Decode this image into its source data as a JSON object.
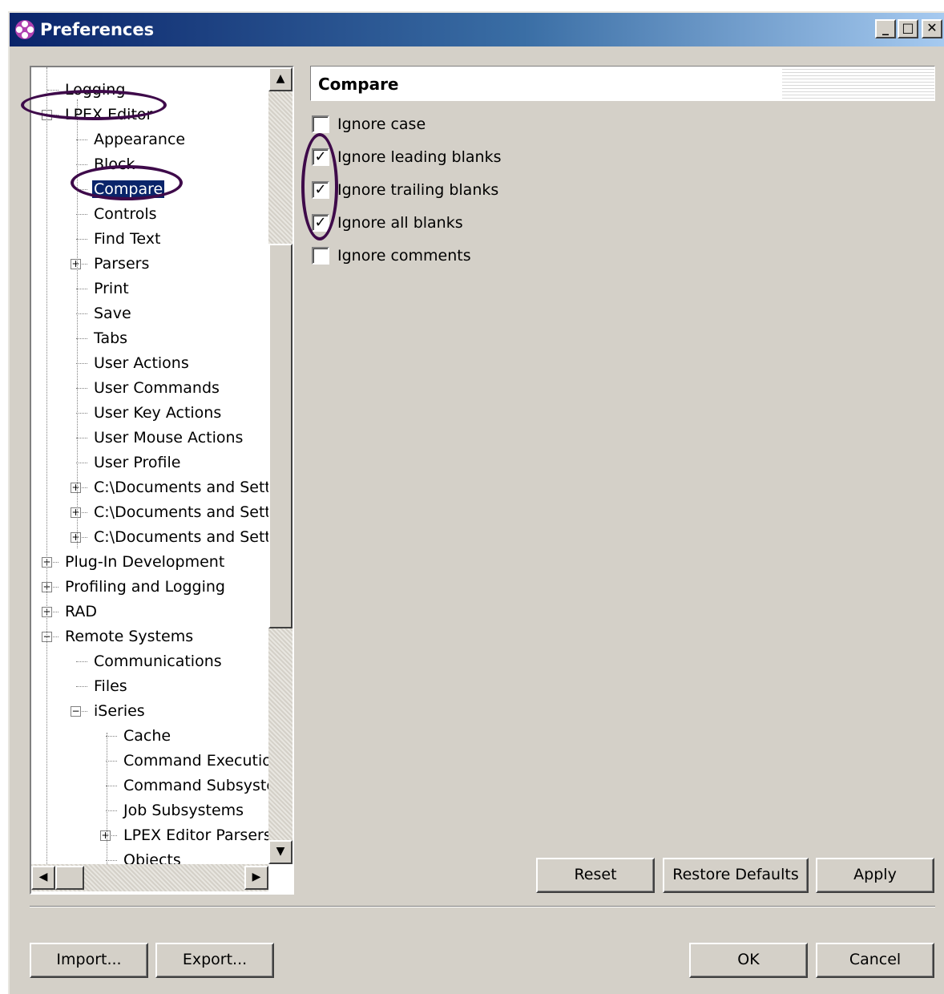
{
  "window": {
    "title": "Preferences"
  },
  "tree": {
    "items": [
      {
        "label": "Logging",
        "level": 1,
        "expander": ""
      },
      {
        "label": "LPEX Editor",
        "level": 1,
        "expander": "−"
      },
      {
        "label": "Appearance",
        "level": 2,
        "expander": ""
      },
      {
        "label": "Block",
        "level": 2,
        "expander": ""
      },
      {
        "label": "Compare",
        "level": 2,
        "expander": "",
        "selected": true
      },
      {
        "label": "Controls",
        "level": 2,
        "expander": ""
      },
      {
        "label": "Find Text",
        "level": 2,
        "expander": ""
      },
      {
        "label": "Parsers",
        "level": 2,
        "expander": "+"
      },
      {
        "label": "Print",
        "level": 2,
        "expander": ""
      },
      {
        "label": "Save",
        "level": 2,
        "expander": ""
      },
      {
        "label": "Tabs",
        "level": 2,
        "expander": ""
      },
      {
        "label": "User Actions",
        "level": 2,
        "expander": ""
      },
      {
        "label": "User Commands",
        "level": 2,
        "expander": ""
      },
      {
        "label": "User Key Actions",
        "level": 2,
        "expander": ""
      },
      {
        "label": "User Mouse Actions",
        "level": 2,
        "expander": ""
      },
      {
        "label": "User Profile",
        "level": 2,
        "expander": ""
      },
      {
        "label": "C:\\Documents and Sett",
        "level": 2,
        "expander": "+"
      },
      {
        "label": "C:\\Documents and Sett",
        "level": 2,
        "expander": "+"
      },
      {
        "label": "C:\\Documents and Sett",
        "level": 2,
        "expander": "+"
      },
      {
        "label": "Plug-In Development",
        "level": 1,
        "expander": "+"
      },
      {
        "label": "Profiling and Logging",
        "level": 1,
        "expander": "+"
      },
      {
        "label": "RAD",
        "level": 1,
        "expander": "+"
      },
      {
        "label": "Remote Systems",
        "level": 1,
        "expander": "−"
      },
      {
        "label": "Communications",
        "level": 2,
        "expander": ""
      },
      {
        "label": "Files",
        "level": 2,
        "expander": ""
      },
      {
        "label": "iSeries",
        "level": 2,
        "expander": "−"
      },
      {
        "label": "Cache",
        "level": 3,
        "expander": ""
      },
      {
        "label": "Command Executio",
        "level": 3,
        "expander": ""
      },
      {
        "label": "Command Subsyste",
        "level": 3,
        "expander": ""
      },
      {
        "label": "Job Subsystems",
        "level": 3,
        "expander": ""
      },
      {
        "label": "LPEX Editor Parsers",
        "level": 3,
        "expander": "+"
      },
      {
        "label": "Objects",
        "level": 3,
        "expander": ""
      }
    ]
  },
  "page": {
    "title": "Compare",
    "options": [
      {
        "label": "Ignore case",
        "checked": false
      },
      {
        "label": "Ignore leading blanks",
        "checked": true
      },
      {
        "label": "Ignore trailing blanks",
        "checked": true
      },
      {
        "label": "Ignore all blanks",
        "checked": true
      },
      {
        "label": "Ignore comments",
        "checked": false
      }
    ],
    "reset_label": "Reset",
    "restore_defaults_label": "Restore Defaults",
    "apply_label": "Apply"
  },
  "footer": {
    "import_label": "Import...",
    "export_label": "Export...",
    "ok_label": "OK",
    "cancel_label": "Cancel"
  },
  "colors": {
    "title_start": "#0a246a",
    "title_end": "#a6caf0",
    "face": "#d4d0c8",
    "annotation": "#3e0a4a"
  }
}
